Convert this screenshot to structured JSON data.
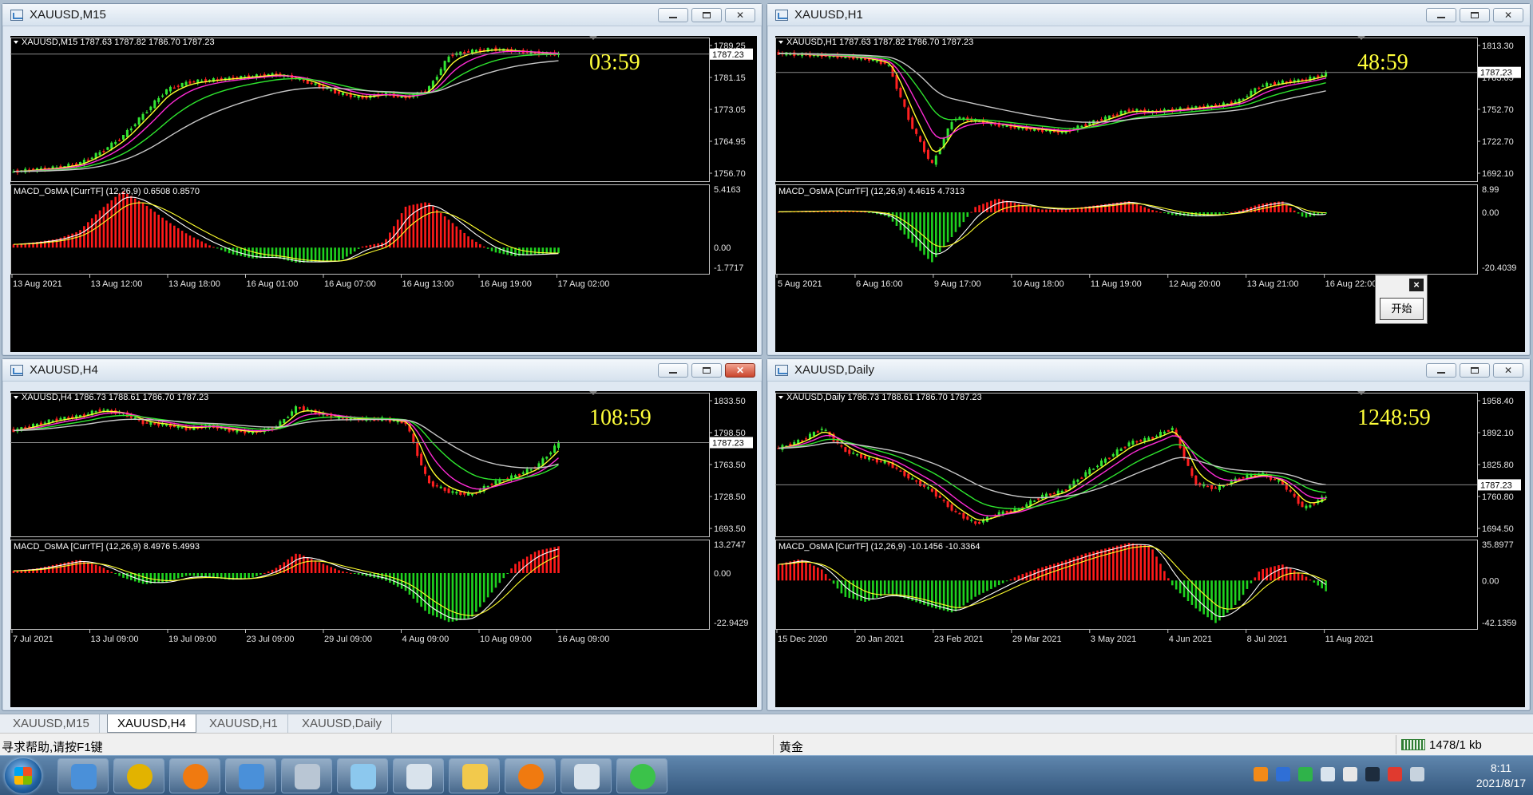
{
  "windows": [
    {
      "title": "XAUUSD,M15",
      "header": "XAUUSD,M15  1787.63 1787.82 1786.70 1787.23",
      "timer": "03:59",
      "price_tag": "1787.23",
      "active": false,
      "y_labels": [
        "1789.25",
        "1781.15",
        "1773.05",
        "1764.95",
        "1756.70"
      ],
      "macd_header": "MACD_OsMA [CurrTF] (12,26,9) 0.6508 0.8570",
      "macd_labels": [
        "5.4163",
        "0.00",
        "-1.7717"
      ],
      "x_labels": [
        "13 Aug 2021",
        "13 Aug 12:00",
        "13 Aug 18:00",
        "16 Aug 01:00",
        "16 Aug 07:00",
        "16 Aug 13:00",
        "16 Aug 19:00",
        "17 Aug 02:00"
      ],
      "price_series": [
        1757,
        1757.5,
        1758,
        1759,
        1762,
        1766,
        1772,
        1778,
        1780,
        1780.5,
        1781,
        1781.5,
        1782,
        1781,
        1779,
        1777,
        1776,
        1777,
        1776,
        1778,
        1787,
        1788,
        1788.5,
        1788,
        1787.5,
        1787.2
      ],
      "macd_series": [
        0.3,
        0.5,
        0.8,
        1.5,
        3.5,
        5.2,
        4.0,
        2.5,
        1.2,
        0.2,
        -0.6,
        -1.0,
        -0.9,
        -1.4,
        -1.3,
        -1.2,
        0.1,
        0.5,
        3.8,
        4.2,
        2.5,
        0.8,
        -0.4,
        -0.8,
        -0.6,
        -0.5
      ],
      "y_range": [
        1754.5,
        1791.5
      ],
      "macd_range": [
        -2.4,
        5.8
      ]
    },
    {
      "title": "XAUUSD,H1",
      "header": "XAUUSD,H1  1787.63 1787.82 1786.70 1787.23",
      "timer": "48:59",
      "price_tag": "1787.23",
      "active": false,
      "y_labels": [
        "1813.30",
        "1783.05",
        "1752.70",
        "1722.70",
        "1692.10"
      ],
      "macd_header": "MACD_OsMA [CurrTF] (12,26,9) 4.4615 4.7313",
      "macd_labels": [
        "8.99",
        "0.00",
        "-20.4039"
      ],
      "x_labels": [
        "5 Aug 2021",
        "6 Aug 16:00",
        "9 Aug 17:00",
        "10 Aug 18:00",
        "11 Aug 19:00",
        "12 Aug 20:00",
        "13 Aug 21:00",
        "16 Aug 22:00"
      ],
      "price_series": [
        1805,
        1804,
        1803,
        1802,
        1800,
        1795,
        1740,
        1700,
        1745,
        1742,
        1738,
        1735,
        1733,
        1731,
        1738,
        1745,
        1752,
        1750,
        1752,
        1754,
        1756,
        1760,
        1775,
        1778,
        1780,
        1786
      ],
      "macd_series": [
        0.2,
        0.4,
        0.5,
        0.5,
        0.2,
        -1.5,
        -10,
        -18,
        -8,
        2,
        5,
        3,
        1,
        1,
        2,
        3,
        4,
        1,
        -1,
        -1.5,
        -1,
        0.5,
        3,
        4,
        -2,
        -0.5
      ],
      "y_range": [
        1685,
        1820
      ],
      "macd_range": [
        -22,
        10
      ]
    },
    {
      "title": "XAUUSD,H4",
      "header": "XAUUSD,H4  1786.73 1788.61 1786.70 1787.23",
      "timer": "108:59",
      "price_tag": "1787.23",
      "active": true,
      "y_labels": [
        "1833.50",
        "1798.50",
        "1763.50",
        "1728.50",
        "1693.50"
      ],
      "macd_header": "MACD_OsMA [CurrTF] (12,26,9) 8.4976 5.4993",
      "macd_labels": [
        "13.2747",
        "0.00",
        "-22.9429"
      ],
      "x_labels": [
        "7 Jul 2021",
        "13 Jul 09:00",
        "19 Jul 09:00",
        "23 Jul 09:00",
        "29 Jul 09:00",
        "4 Aug 09:00",
        "10 Aug 09:00",
        "16 Aug 09:00"
      ],
      "price_series": [
        1800,
        1806,
        1812,
        1815,
        1822,
        1818,
        1808,
        1806,
        1802,
        1805,
        1800,
        1798,
        1803,
        1825,
        1818,
        1813,
        1812,
        1812,
        1808,
        1745,
        1735,
        1732,
        1745,
        1752,
        1762,
        1787
      ],
      "macd_series": [
        1,
        2,
        4,
        6,
        3,
        -2,
        -5,
        -4,
        -1,
        -2,
        -3,
        -2,
        2,
        9,
        5,
        1,
        -1,
        -3,
        -8,
        -18,
        -22,
        -20,
        -8,
        4,
        10,
        12
      ],
      "y_range": [
        1688,
        1840
      ],
      "macd_range": [
        -25,
        15
      ]
    },
    {
      "title": "XAUUSD,Daily",
      "header": "XAUUSD,Daily  1786.73 1788.61 1786.70 1787.23",
      "timer": "1248:59",
      "price_tag": "1787.23",
      "active": false,
      "y_labels": [
        "1958.40",
        "1892.10",
        "1825.80",
        "1760.80",
        "1694.50"
      ],
      "macd_header": "MACD_OsMA [CurrTF] (12,26,9) -10.1456 -10.3364",
      "macd_labels": [
        "35.8977",
        "0.00",
        "-42.1359"
      ],
      "x_labels": [
        "15 Dec 2020",
        "20 Jan 2021",
        "23 Feb 2021",
        "29 Mar 2021",
        "3 May 2021",
        "4 Jun 2021",
        "8 Jul 2021",
        "11 Aug 2021"
      ],
      "price_series": [
        1860,
        1875,
        1900,
        1855,
        1840,
        1830,
        1800,
        1775,
        1735,
        1710,
        1730,
        1740,
        1765,
        1775,
        1810,
        1840,
        1870,
        1880,
        1900,
        1790,
        1780,
        1800,
        1810,
        1790,
        1740,
        1765
      ],
      "macd_series": [
        15,
        20,
        10,
        -15,
        -20,
        -12,
        -18,
        -25,
        -30,
        -15,
        -5,
        5,
        12,
        18,
        25,
        30,
        35,
        32,
        -5,
        -25,
        -40,
        -20,
        10,
        15,
        5,
        -10
      ],
      "y_range": [
        1685,
        1970
      ],
      "macd_range": [
        -45,
        38
      ]
    }
  ],
  "tabs": [
    "XAUUSD,M15",
    "XAUUSD,H4",
    "XAUUSD,H1",
    "XAUUSD,Daily"
  ],
  "active_tab": 1,
  "status": {
    "help": "寻求帮助,请按F1键",
    "symbol": "黄金",
    "traffic": "1478/1 kb"
  },
  "popup": {
    "close": "×",
    "start": "开始"
  },
  "clock": {
    "time": "8:11",
    "date": "2021/8/17"
  },
  "colors": {
    "up_hist": "#ff1a1a",
    "down_hist": "#1fd21f",
    "ma_yellow": "#ffff2e",
    "ma_magenta": "#ff2bd6",
    "ma_green": "#2ee62e",
    "ma_gray": "#c8c8c8",
    "timer": "#ffff3a"
  },
  "taskbar_icons": [
    "contacts-icon",
    "dollar-app-icon",
    "orange-swirl-icon",
    "contacts-icon",
    "camera-icon",
    "notebook-icon",
    "chart-tool-icon",
    "folder-icon",
    "ninja-icon",
    "chart-tool-icon",
    "wechat-icon"
  ]
}
